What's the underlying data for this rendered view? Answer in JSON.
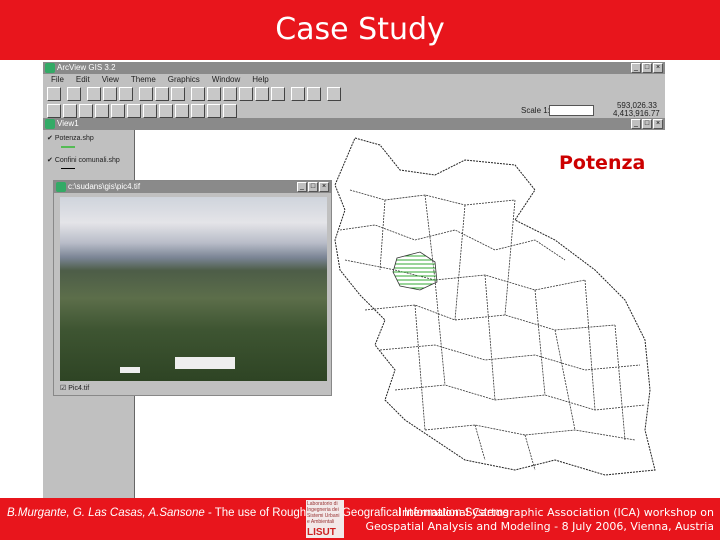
{
  "slide": {
    "title": "Case Study"
  },
  "app": {
    "title": "ArcView GIS 3.2",
    "menu": [
      "File",
      "Edit",
      "View",
      "Theme",
      "Graphics",
      "Window",
      "Help"
    ],
    "scale_label": "Scale 1:",
    "scale_value": "",
    "coords": [
      "593,026.33",
      "4,413,916.77"
    ],
    "view_title": "View1",
    "legend": [
      "Potenza.shp",
      "Confini comunali.shp"
    ],
    "map_label": "Potenza",
    "image_window": {
      "title": "c:\\sudans\\gis\\pic4.tif",
      "legend": "Pic4.tif"
    }
  },
  "footer": {
    "authors": "B.Murgante, G. Las Casas, A.Sansone",
    "paper": " - The use of Rough Set in Geografical Information Systems",
    "logo_text": "Laboratorio di Ingegneria dei Sistemi Urbani e Ambientali",
    "logo_mark": "LISUT",
    "event": "International Cartographic Association (ICA) workshop  on",
    "event2": "Geospatial Analysis and Modeling - 8 July 2006, Vienna, Austria"
  },
  "colors": {
    "red": "#e8151c",
    "label": "#cc0000"
  }
}
